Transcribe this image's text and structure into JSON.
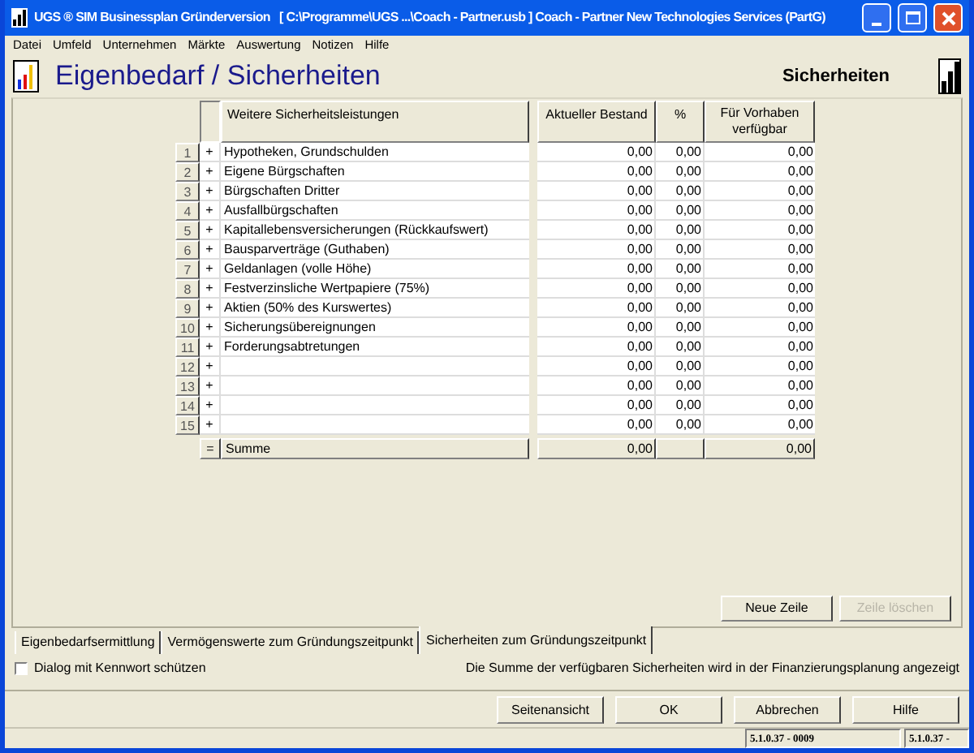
{
  "window": {
    "title": "UGS ® SIM Businessplan Gründerversion   [ C:\\Programme\\UGS ...\\Coach - Partner.usb ] Coach - Partner New Technologies Services (PartG)"
  },
  "menu": [
    "Datei",
    "Umfeld",
    "Unternehmen",
    "Märkte",
    "Auswertung",
    "Notizen",
    "Hilfe"
  ],
  "header": {
    "title": "Eigenbedarf / Sicherheiten",
    "section": "Sicherheiten"
  },
  "table": {
    "columns": [
      "Weitere Sicherheitsleistungen",
      "Aktueller Bestand",
      "%",
      "Für Vorhaben verfügbar"
    ],
    "rows": [
      {
        "number": "1",
        "sign": "+",
        "label": "Hypotheken, Grundschulden",
        "bestand": "0,00",
        "percent": "0,00",
        "available": "0,00"
      },
      {
        "number": "2",
        "sign": "+",
        "label": "Eigene Bürgschaften",
        "bestand": "0,00",
        "percent": "0,00",
        "available": "0,00"
      },
      {
        "number": "3",
        "sign": "+",
        "label": "Bürgschaften Dritter",
        "bestand": "0,00",
        "percent": "0,00",
        "available": "0,00"
      },
      {
        "number": "4",
        "sign": "+",
        "label": "Ausfallbürgschaften",
        "bestand": "0,00",
        "percent": "0,00",
        "available": "0,00"
      },
      {
        "number": "5",
        "sign": "+",
        "label": "Kapitallebensversicherungen (Rückkaufswert)",
        "bestand": "0,00",
        "percent": "0,00",
        "available": "0,00"
      },
      {
        "number": "6",
        "sign": "+",
        "label": "Bausparverträge (Guthaben)",
        "bestand": "0,00",
        "percent": "0,00",
        "available": "0,00"
      },
      {
        "number": "7",
        "sign": "+",
        "label": "Geldanlagen (volle Höhe)",
        "bestand": "0,00",
        "percent": "0,00",
        "available": "0,00"
      },
      {
        "number": "8",
        "sign": "+",
        "label": "Festverzinsliche Wertpapiere (75%)",
        "bestand": "0,00",
        "percent": "0,00",
        "available": "0,00"
      },
      {
        "number": "9",
        "sign": "+",
        "label": "Aktien (50% des Kurswertes)",
        "bestand": "0,00",
        "percent": "0,00",
        "available": "0,00"
      },
      {
        "number": "10",
        "sign": "+",
        "label": "Sicherungsübereignungen",
        "bestand": "0,00",
        "percent": "0,00",
        "available": "0,00"
      },
      {
        "number": "11",
        "sign": "+",
        "label": "Forderungsabtretungen",
        "bestand": "0,00",
        "percent": "0,00",
        "available": "0,00"
      },
      {
        "number": "12",
        "sign": "+",
        "bestand": "0,00",
        "percent": "0,00",
        "available": "0,00"
      },
      {
        "number": "13",
        "sign": "+",
        "bestand": "0,00",
        "percent": "0,00",
        "available": "0,00"
      },
      {
        "number": "14",
        "sign": "+",
        "bestand": "0,00",
        "percent": "0,00",
        "available": "0,00"
      },
      {
        "number": "15",
        "sign": "+",
        "bestand": "0,00",
        "percent": "0,00",
        "available": "0,00"
      }
    ],
    "total": {
      "sign": "=",
      "label": "Summe",
      "bestand": "0,00",
      "available": "0,00"
    }
  },
  "row_buttons": [
    {
      "label": "Neue Zeile",
      "disabled": false
    },
    {
      "label": "Zeile löschen",
      "disabled": true
    }
  ],
  "tabs": [
    {
      "label": "Eigenbedarfsermittlung",
      "selected": false
    },
    {
      "label": "Vermögenswerte zum Gründungszeitpunkt",
      "selected": false
    },
    {
      "label": "Sicherheiten zum Gründungszeitpunkt",
      "selected": true
    }
  ],
  "password_checkbox": {
    "label": "Dialog mit Kennwort schützen",
    "checked": false
  },
  "note": "Die Summe der verfügbaren Sicherheiten wird in der Finanzierungsplanung angezeigt",
  "buttons": [
    "Seitenansicht",
    "OK",
    "Abbrechen",
    "Hilfe"
  ],
  "status_bar": [
    "5.1.0.37 - 0009",
    "5.1.0.37 -"
  ]
}
